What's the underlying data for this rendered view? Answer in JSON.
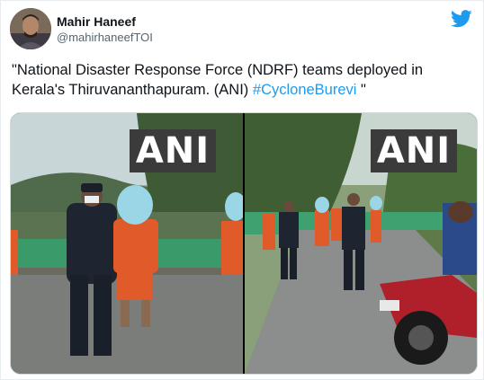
{
  "tweet": {
    "display_name": "Mahir Haneef",
    "handle": "@mahirhaneefTOI",
    "text_before": "\"National Disaster Response Force (NDRF) teams deployed in Kerala's Thiruvananthapuram. (ANI) ",
    "hashtag": "#CycloneBurevi",
    "text_after": " \""
  },
  "media": {
    "watermark_left": "ANI",
    "watermark_right": "ANI"
  },
  "icons": {
    "platform": "twitter-bird-icon"
  },
  "colors": {
    "link": "#1d9bf0",
    "twitter_blue": "#1d9bf0"
  }
}
